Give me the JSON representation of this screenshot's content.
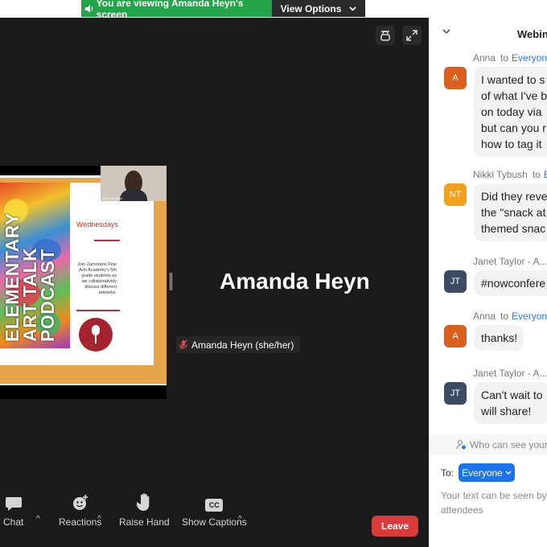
{
  "share_banner": {
    "message": "You are viewing Amanda Heyn's screen",
    "view_options_label": "View Options",
    "banner_color": "#23a44a"
  },
  "shared_slide": {
    "title_lines": [
      "ELEMENTARY",
      "ART TALK",
      "PODCAST"
    ],
    "day": "Wednesdays",
    "blurb": "Join Zamorano Fine Arts Academy's 5th grade students as we collaboratively discuss different artworks.",
    "presenter_thumb_label": "Amanda Heyn",
    "accent_color": "#e7a44b"
  },
  "speaker": {
    "display_name": "Amanda Heyn",
    "name_tag": "Amanda Heyn (she/her)",
    "muted": true
  },
  "toolbar": {
    "chat": "Chat",
    "reactions": "Reactions",
    "raise_hand": "Raise Hand",
    "show_captions": "Show Captions",
    "captions_icon_text": "CC",
    "leave": "Leave",
    "leave_color": "#d93b3b"
  },
  "chat_panel": {
    "title": "Webin",
    "messages": [
      {
        "sender": "Anna",
        "to": "to",
        "recipient": "Everyon",
        "initials": "A",
        "avatar_color": "#d95f1e",
        "lines": [
          "I wanted to s",
          "of what I've b",
          "on today via",
          "but can you r",
          "how to tag it"
        ]
      },
      {
        "sender": "Nikki Tybush",
        "to": "to",
        "recipient": "E",
        "initials": "NT",
        "avatar_color": "#f1a11e",
        "lines": [
          "Did they reve",
          "the \"snack at",
          "themed snac"
        ]
      },
      {
        "sender": "Janet Taylor - A...",
        "to": "",
        "recipient": "",
        "initials": "JT",
        "avatar_color": "#3c4d63",
        "lines": [
          "#nowconfere"
        ]
      },
      {
        "sender": "Anna",
        "to": "to",
        "recipient": "Everyon",
        "initials": "A",
        "avatar_color": "#d95f1e",
        "lines": [
          "thanks!"
        ]
      },
      {
        "sender": "Janet Taylor - A...",
        "to": "",
        "recipient": "",
        "initials": "JT",
        "avatar_color": "#3c4d63",
        "lines": [
          "Can't wait to",
          "will share!"
        ]
      }
    ],
    "who_can_see": "Who can see your r",
    "to_label": "To:",
    "recipient_selected": "Everyone",
    "input_placeholder_lines": [
      "Your text can be seen by",
      "attendees"
    ]
  }
}
